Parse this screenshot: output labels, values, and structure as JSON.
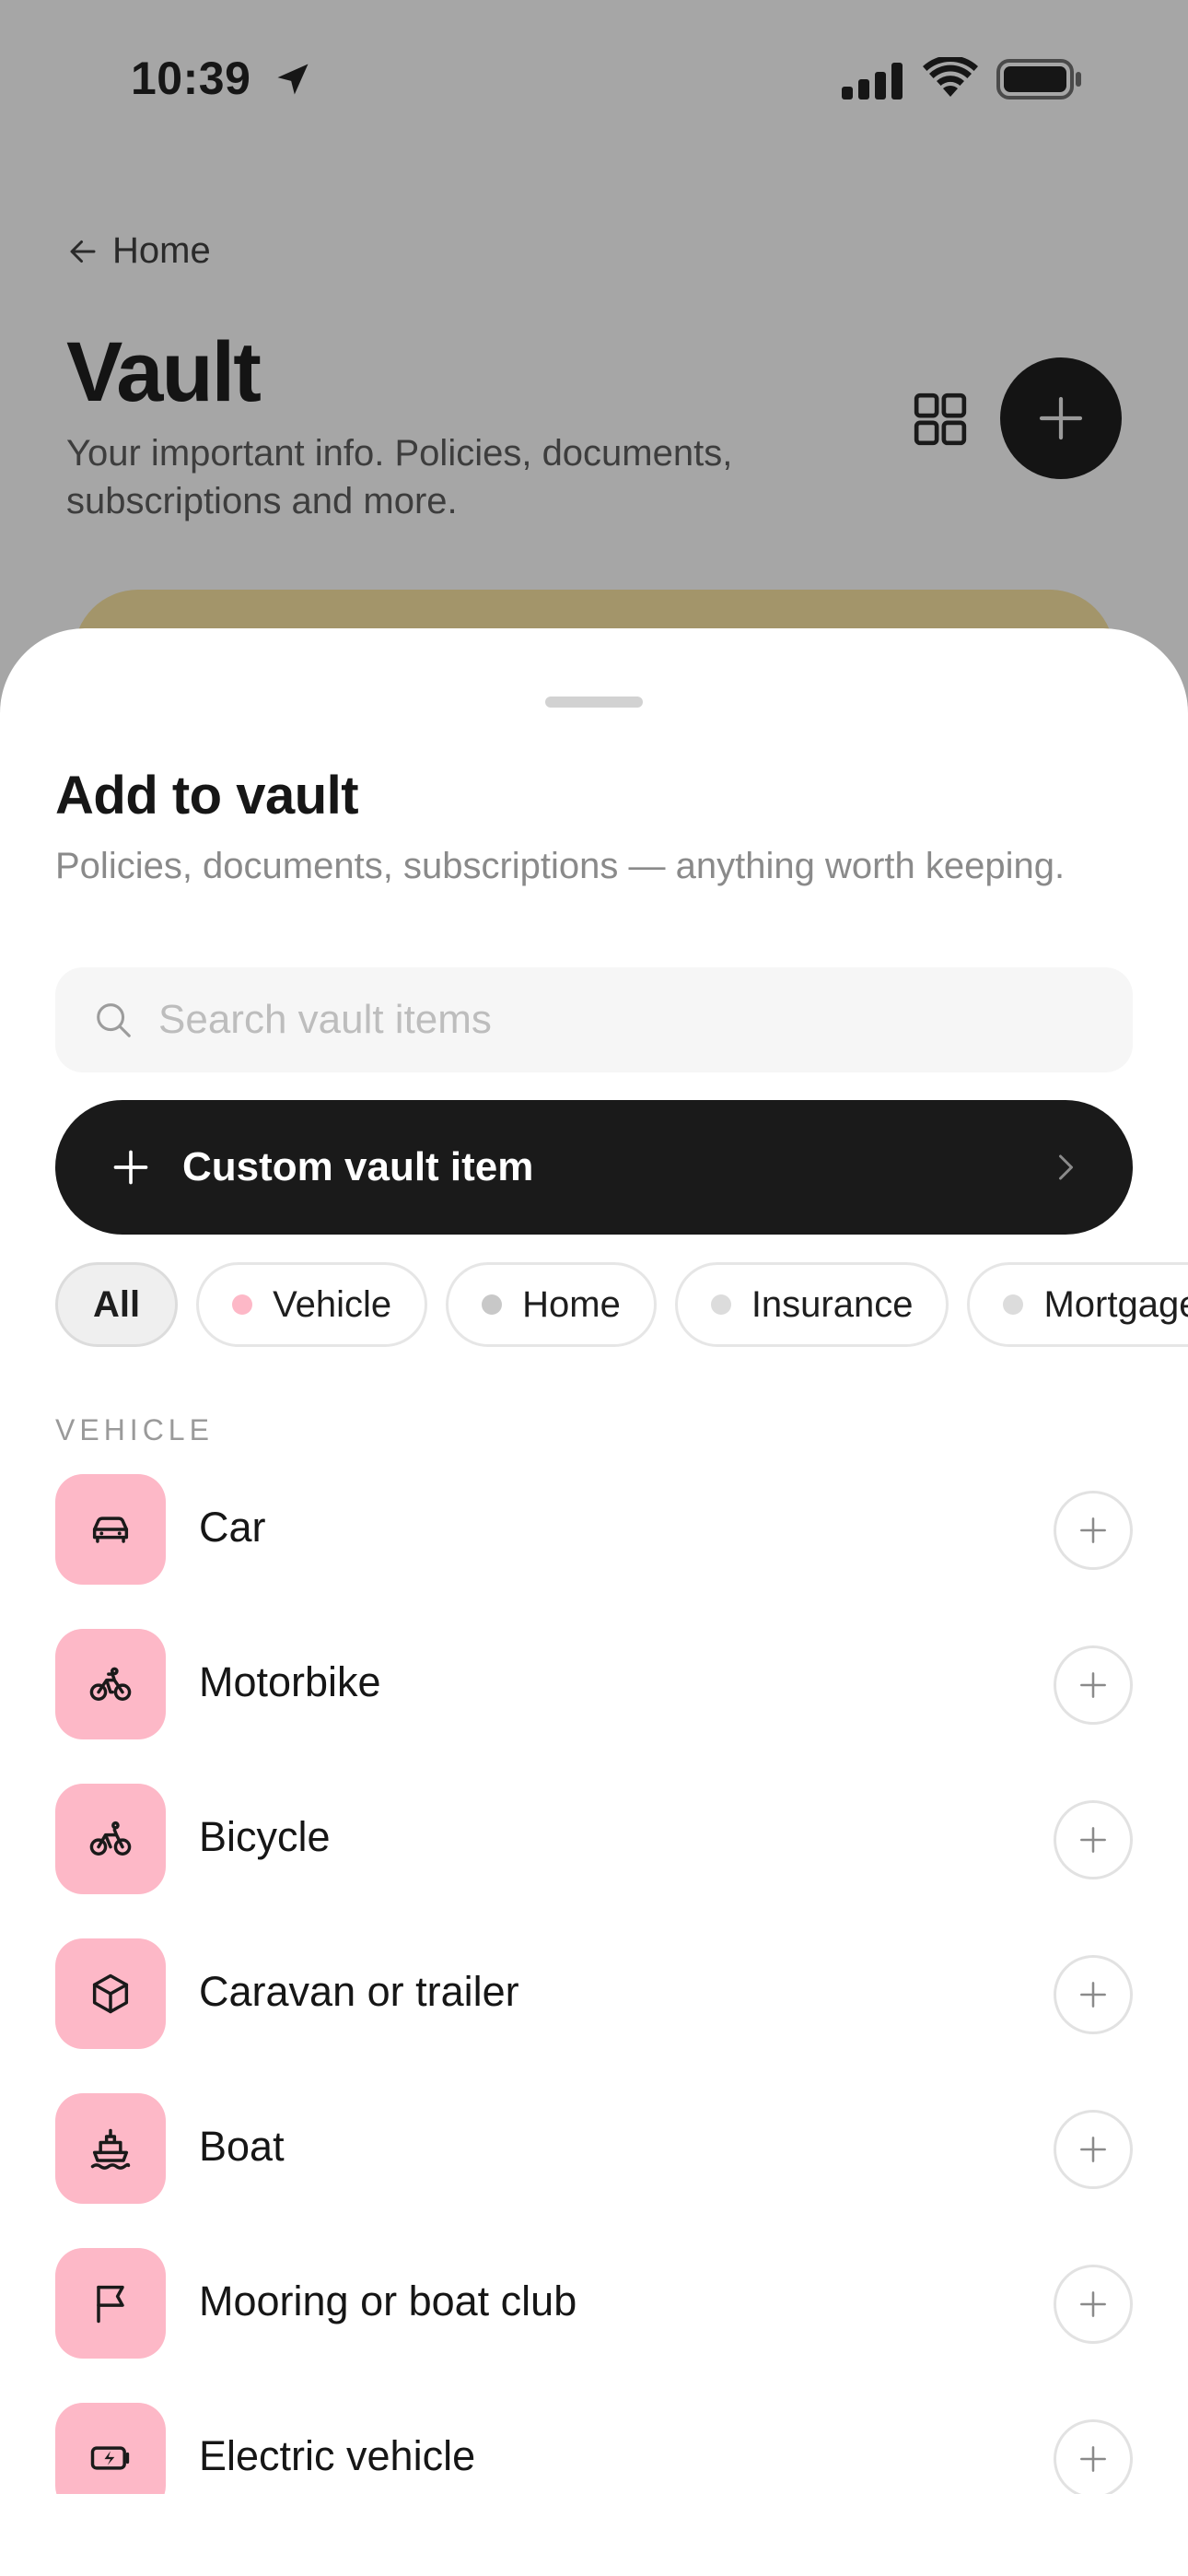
{
  "status_bar": {
    "time": "10:39",
    "icons": [
      "location-arrow-icon",
      "cellular-signal-icon",
      "wifi-icon",
      "battery-icon"
    ]
  },
  "background_page": {
    "back_label": "Home",
    "title": "Vault",
    "subtitle": "Your important info. Policies, documents, subscriptions and more.",
    "banner_color": "#a3956a"
  },
  "sheet": {
    "title": "Add to vault",
    "description": "Policies, documents, subscriptions — anything worth keeping.",
    "search": {
      "placeholder": "Search vault items",
      "value": ""
    },
    "custom_button_label": "Custom vault item",
    "chips": [
      {
        "label": "All",
        "active": true,
        "dot_color": ""
      },
      {
        "label": "Vehicle",
        "active": false,
        "dot_color": "#fdb8c7"
      },
      {
        "label": "Home",
        "active": false,
        "dot_color": "#c8c8c8"
      },
      {
        "label": "Insurance",
        "active": false,
        "dot_color": "#dcdcdc"
      },
      {
        "label": "Mortgage",
        "active": false,
        "dot_color": "#dcdcdc"
      }
    ],
    "section_label": "VEHICLE",
    "items": [
      {
        "label": "Car",
        "icon": "car-icon"
      },
      {
        "label": "Motorbike",
        "icon": "motorbike-icon"
      },
      {
        "label": "Bicycle",
        "icon": "bicycle-icon"
      },
      {
        "label": "Caravan or trailer",
        "icon": "box-icon"
      },
      {
        "label": "Boat",
        "icon": "boat-icon"
      },
      {
        "label": "Mooring or boat club",
        "icon": "flag-icon"
      },
      {
        "label": "Electric vehicle",
        "icon": "charging-battery-icon"
      }
    ]
  },
  "colors": {
    "accent_dark": "#1a1a1a",
    "vehicle_tile": "#fdb8c7",
    "overlay_bg": "#a6a6a6"
  }
}
